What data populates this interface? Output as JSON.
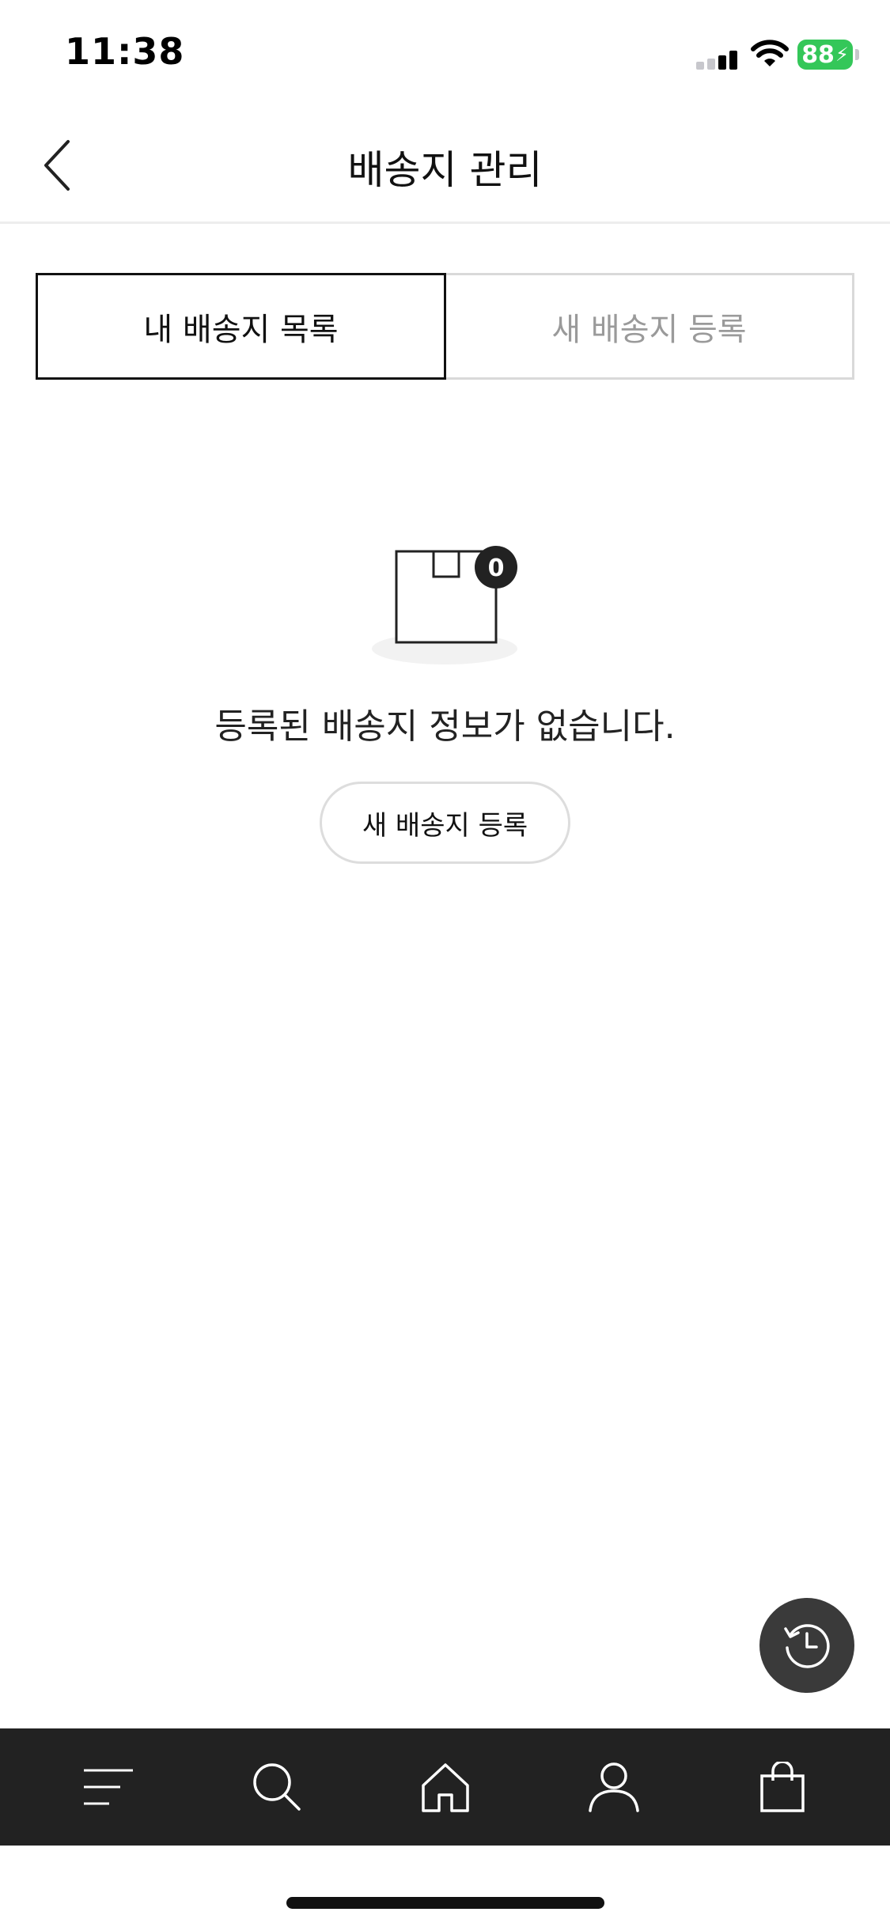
{
  "status_bar": {
    "time": "11:38",
    "battery_level": "88",
    "icons": [
      "signal-icon",
      "wifi-icon",
      "battery-charging-icon"
    ]
  },
  "header": {
    "title": "배송지 관리",
    "back_icon": "chevron-left-icon"
  },
  "tabs": [
    {
      "label": "내 배송지 목록",
      "active": true
    },
    {
      "label": "새 배송지 등록",
      "active": false
    }
  ],
  "empty_state": {
    "badge_count": "0",
    "illustration_icon": "empty-box-icon",
    "message": "등록된 배송지 정보가 없습니다.",
    "button_label": "새 배송지 등록"
  },
  "fab": {
    "icon": "history-icon"
  },
  "bottom_nav": {
    "items": [
      "menu-icon",
      "search-icon",
      "home-icon",
      "user-icon",
      "shopping-bag-icon"
    ]
  },
  "colors": {
    "accent_dark": "#222222",
    "battery_green": "#34c759",
    "inactive_text": "#9a9a9a",
    "border_light": "#d9d9d9"
  }
}
